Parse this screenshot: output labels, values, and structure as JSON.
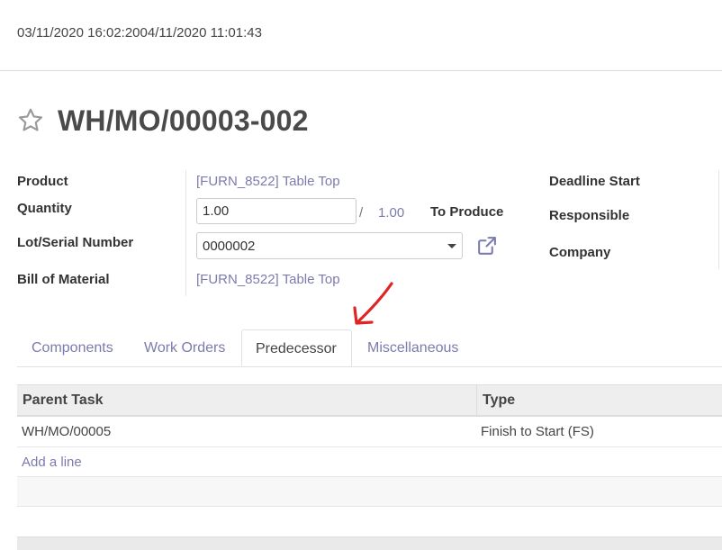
{
  "header": {
    "datetime_range": "03/11/2020 16:02:2004/11/2020 11:01:43"
  },
  "record": {
    "title": "WH/MO/00003-002",
    "favorite_icon": "star-outline-icon"
  },
  "fields": {
    "product_label": "Product",
    "product_value": "[FURN_8522] Table Top",
    "quantity_label": "Quantity",
    "quantity_value": "1.00",
    "quantity_separator": "/",
    "quantity_total": "1.00",
    "to_produce_label": "To Produce",
    "lot_label": "Lot/Serial Number",
    "lot_value": "0000002",
    "bom_label": "Bill of Material",
    "bom_value": "[FURN_8522] Table Top",
    "deadline_label": "Deadline Start",
    "responsible_label": "Responsible",
    "company_label": "Company"
  },
  "tabs": [
    {
      "label": "Components"
    },
    {
      "label": "Work Orders"
    },
    {
      "label": "Predecessor"
    },
    {
      "label": "Miscellaneous"
    }
  ],
  "predecessor_table": {
    "columns": [
      "Parent Task",
      "Type"
    ],
    "rows": [
      {
        "parent_task": "WH/MO/00005",
        "type": "Finish to Start (FS)"
      }
    ],
    "add_line": "Add a line"
  },
  "colors": {
    "link": "#7c7bad",
    "annotation_arrow": "#e02424"
  }
}
